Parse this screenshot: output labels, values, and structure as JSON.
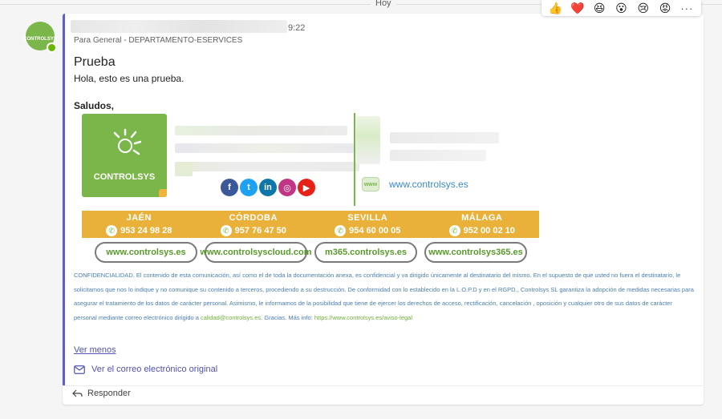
{
  "day_separator": "Hoy",
  "reactions": [
    "👍",
    "❤️",
    "😆",
    "😮",
    "😢",
    "😡"
  ],
  "reactions_more": "···",
  "avatar": {
    "logo_text": "CONTROLSYS"
  },
  "message": {
    "time": "9:22",
    "channel": "Para General - DEPARTAMENTO-ESERVICES",
    "subject": "Prueba",
    "body": "Hola, esto es una prueba.",
    "greeting": "Saludos,"
  },
  "signature": {
    "brand": "CONTROLSYS",
    "web": "www.controlsys.es",
    "web_icon": "www",
    "social": [
      {
        "name": "facebook",
        "glyph": "f",
        "color": "#3b5998"
      },
      {
        "name": "twitter",
        "glyph": "t",
        "color": "#1da1f2"
      },
      {
        "name": "linkedin",
        "glyph": "in",
        "color": "#0e76a8"
      },
      {
        "name": "instagram",
        "glyph": "◎",
        "color": "#c13584"
      },
      {
        "name": "youtube",
        "glyph": "▶",
        "color": "#e62117"
      }
    ],
    "offices": [
      {
        "city": "JAÉN",
        "phone": "953 24 98 28"
      },
      {
        "city": "CÓRDOBA",
        "phone": "957 76 47 50"
      },
      {
        "city": "SEVILLA",
        "phone": "954 60 00 05"
      },
      {
        "city": "MÁLAGA",
        "phone": "952 00 02 10"
      }
    ],
    "links": [
      "www.controlsys.es",
      "www.controlsyscloud.com",
      "m365.controlsys.es",
      "www.controlsys365.es"
    ]
  },
  "legal": {
    "text": "CONFIDENCIALIDAD. El contenido de esta comunicación, así como el de toda la documentación anexa, es confidencial y va dirigido únicamente al destinatario del mismo. En el supuesto de que usted no fuera el destinatario, le solicitamos que nos lo indique y no comunique su contenido a terceros, procediendo a su destrucción. De conformidad con lo establecido en la L.O.P.D y en el RGPD., Controlsys SL garantiza la adopción de medidas necesarias para asegurar el tratamiento de los datos de carácter personal. Asimismo, le informamos de la posibilidad que tiene de ejercer los derechos de acceso, rectificación, cancelación , oposición y cualquier otro de sus datos de carácter personal mediante correo electrónico dirigido a",
    "email": "calidad@controlsys.es",
    "thanks": ". Gracias. Más info:",
    "url": "https://www.controlsys.es/aviso-legal"
  },
  "actions": {
    "see_less": "Ver menos",
    "view_original": "Ver el correo electrónico original",
    "reply": "Responder"
  },
  "colors": {
    "accent": "#5b5fc7",
    "brand_green": "#7ab64a",
    "office_bar": "#e9b13a",
    "link": "#4f52b2"
  }
}
